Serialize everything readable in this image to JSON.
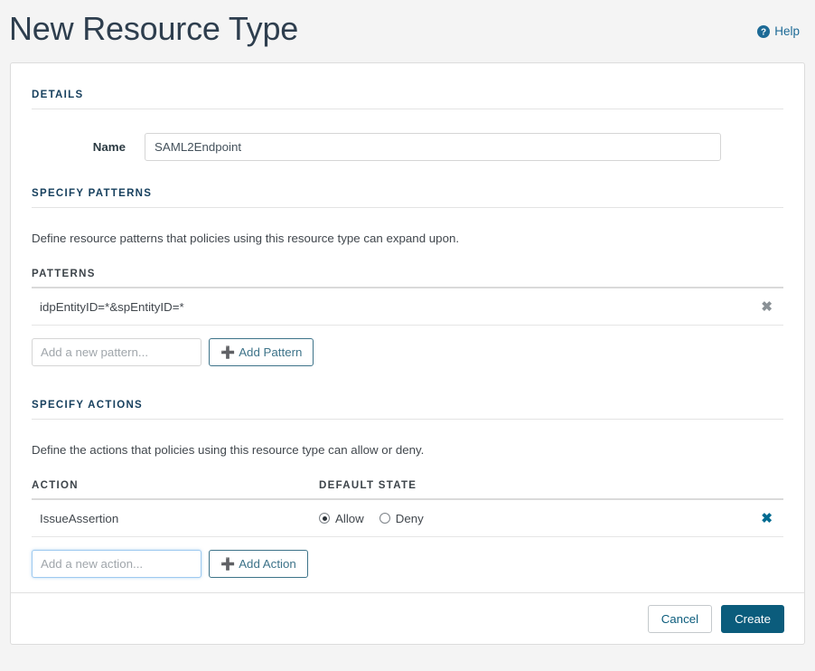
{
  "header": {
    "title": "New Resource Type",
    "help_label": "Help",
    "help_icon": "question-circle-icon"
  },
  "details": {
    "section_label": "DETAILS",
    "name_label": "Name",
    "name_value": "SAML2Endpoint"
  },
  "patterns": {
    "section_label": "SPECIFY PATTERNS",
    "description": "Define resource patterns that policies using this resource type can expand upon.",
    "table_header": "PATTERNS",
    "rows": [
      {
        "value": "idpEntityID=*&spEntityID=*",
        "delete_icon": "close-icon"
      }
    ],
    "add_placeholder": "Add a new pattern...",
    "add_input_value": "",
    "add_button_label": "Add Pattern"
  },
  "actions": {
    "section_label": "SPECIFY ACTIONS",
    "description": "Define the actions that policies using this resource type can allow or deny.",
    "columns": {
      "action": "ACTION",
      "default_state": "DEFAULT STATE"
    },
    "rows": [
      {
        "name": "IssueAssertion",
        "allow_label": "Allow",
        "deny_label": "Deny",
        "selected": "Allow",
        "delete_icon": "close-icon"
      }
    ],
    "add_placeholder": "Add a new action...",
    "add_input_value": "",
    "add_button_label": "Add Action"
  },
  "footer": {
    "cancel_label": "Cancel",
    "create_label": "Create"
  },
  "colors": {
    "page_background": "#f4f4f4",
    "card_background": "#ffffff",
    "section_header": "#17405e",
    "accent": "#0b5c7c",
    "link": "#1d6a96",
    "add_button_border": "#3d7389",
    "delete_muted": "#8a9196",
    "delete_accent": "#006b91"
  }
}
